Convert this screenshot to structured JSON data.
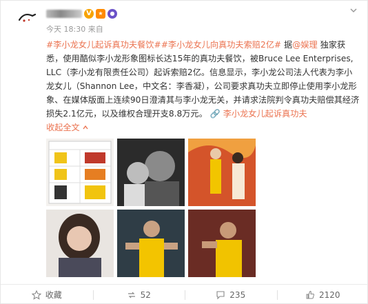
{
  "post": {
    "time": "今天 18:30 来自",
    "text_before": "",
    "tag1": "#李小龙女儿起诉真功夫餐饮#",
    "tag2": "#李小龙女儿向真功夫索赔2亿#",
    "sep1": " 据",
    "mention": "@娱理",
    "body": " 独家获悉，使用酷似李小龙形象图标长达15年的真功夫餐饮，被Bruce Lee Enterprises, LLC（李小龙有限责任公司）起诉索赔2亿。信息显示，李小龙公司法人代表为李小龙女儿（Shannon Lee，中文名：李香凝），公司要求真功夫立即停止使用李小龙形象、在媒体版面上连续90日澄清其与李小龙无关，并请求法院判令真功夫赔偿其经济损失2.1亿元，以及维权合理开支8.8万元。",
    "topic_link": "李小龙女儿起诉真功夫",
    "collapse": "收起全文"
  },
  "icons": {
    "verified": "V",
    "more": "chevron-down-icon"
  },
  "footer": {
    "favorite_label": "收藏",
    "repost_count": "52",
    "comment_count": "235",
    "like_count": "2120"
  },
  "colors": {
    "link": "#eb7350",
    "text": "#333333",
    "muted": "#999999"
  }
}
